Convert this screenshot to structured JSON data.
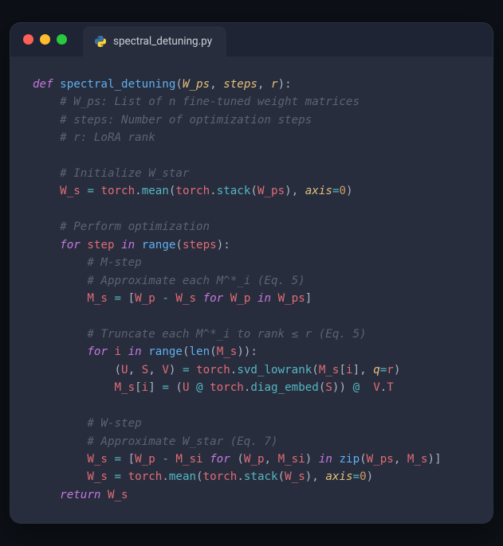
{
  "tab": {
    "filename": "spectral_detuning.py"
  },
  "code": {
    "lines": [
      {
        "indent": 0,
        "tokens": [
          [
            "kw",
            "def"
          ],
          [
            "",
            " "
          ],
          [
            "fn",
            "spectral_detuning"
          ],
          [
            "punct",
            "("
          ],
          [
            "param",
            "W_ps"
          ],
          [
            "punct",
            ","
          ],
          [
            "",
            " "
          ],
          [
            "param",
            "steps"
          ],
          [
            "punct",
            ","
          ],
          [
            "",
            " "
          ],
          [
            "param",
            "r"
          ],
          [
            "punct",
            "):"
          ]
        ]
      },
      {
        "indent": 1,
        "tokens": [
          [
            "comment",
            "# W_ps: List of n fine-tuned weight matrices"
          ]
        ]
      },
      {
        "indent": 1,
        "tokens": [
          [
            "comment",
            "# steps: Number of optimization steps"
          ]
        ]
      },
      {
        "indent": 1,
        "tokens": [
          [
            "comment",
            "# r: LoRA rank"
          ]
        ]
      },
      {
        "indent": 0,
        "tokens": []
      },
      {
        "indent": 1,
        "tokens": [
          [
            "comment",
            "# Initialize W_star"
          ]
        ]
      },
      {
        "indent": 1,
        "tokens": [
          [
            "var",
            "W_s"
          ],
          [
            "",
            " "
          ],
          [
            "op",
            "="
          ],
          [
            "",
            " "
          ],
          [
            "var",
            "torch"
          ],
          [
            "punct",
            "."
          ],
          [
            "method",
            "mean"
          ],
          [
            "punct",
            "("
          ],
          [
            "var",
            "torch"
          ],
          [
            "punct",
            "."
          ],
          [
            "method",
            "stack"
          ],
          [
            "punct",
            "("
          ],
          [
            "var",
            "W_ps"
          ],
          [
            "punct",
            "),"
          ],
          [
            "",
            " "
          ],
          [
            "param",
            "axis"
          ],
          [
            "op",
            "="
          ],
          [
            "num",
            "0"
          ],
          [
            "punct",
            ")"
          ]
        ]
      },
      {
        "indent": 0,
        "tokens": []
      },
      {
        "indent": 1,
        "tokens": [
          [
            "comment",
            "# Perform optimization"
          ]
        ]
      },
      {
        "indent": 1,
        "tokens": [
          [
            "kw",
            "for"
          ],
          [
            "",
            " "
          ],
          [
            "var",
            "step"
          ],
          [
            "",
            " "
          ],
          [
            "kw",
            "in"
          ],
          [
            "",
            " "
          ],
          [
            "fn",
            "range"
          ],
          [
            "punct",
            "("
          ],
          [
            "var",
            "steps"
          ],
          [
            "punct",
            "):"
          ]
        ]
      },
      {
        "indent": 2,
        "tokens": [
          [
            "comment",
            "# M-step"
          ]
        ]
      },
      {
        "indent": 2,
        "tokens": [
          [
            "comment",
            "# Approximate each M^*_i (Eq. 5)"
          ]
        ]
      },
      {
        "indent": 2,
        "tokens": [
          [
            "var",
            "M_s"
          ],
          [
            "",
            " "
          ],
          [
            "op",
            "="
          ],
          [
            "",
            " "
          ],
          [
            "punct",
            "["
          ],
          [
            "var",
            "W_p"
          ],
          [
            "",
            " "
          ],
          [
            "op",
            "-"
          ],
          [
            "",
            " "
          ],
          [
            "var",
            "W_s"
          ],
          [
            "",
            " "
          ],
          [
            "kw",
            "for"
          ],
          [
            "",
            " "
          ],
          [
            "var",
            "W_p"
          ],
          [
            "",
            " "
          ],
          [
            "kw",
            "in"
          ],
          [
            "",
            " "
          ],
          [
            "var",
            "W_ps"
          ],
          [
            "punct",
            "]"
          ]
        ]
      },
      {
        "indent": 0,
        "tokens": []
      },
      {
        "indent": 2,
        "tokens": [
          [
            "comment",
            "# Truncate each M^*_i to rank ≤ r (Eq. 5)"
          ]
        ]
      },
      {
        "indent": 2,
        "tokens": [
          [
            "kw",
            "for"
          ],
          [
            "",
            " "
          ],
          [
            "var",
            "i"
          ],
          [
            "",
            " "
          ],
          [
            "kw",
            "in"
          ],
          [
            "",
            " "
          ],
          [
            "fn",
            "range"
          ],
          [
            "punct",
            "("
          ],
          [
            "fn",
            "len"
          ],
          [
            "punct",
            "("
          ],
          [
            "var",
            "M_s"
          ],
          [
            "punct",
            ")):"
          ]
        ]
      },
      {
        "indent": 3,
        "tokens": [
          [
            "punct",
            "("
          ],
          [
            "var",
            "U"
          ],
          [
            "punct",
            ","
          ],
          [
            "",
            " "
          ],
          [
            "var",
            "S"
          ],
          [
            "punct",
            ","
          ],
          [
            "",
            " "
          ],
          [
            "var",
            "V"
          ],
          [
            "punct",
            ")"
          ],
          [
            "",
            " "
          ],
          [
            "op",
            "="
          ],
          [
            "",
            " "
          ],
          [
            "var",
            "torch"
          ],
          [
            "punct",
            "."
          ],
          [
            "method",
            "svd_lowrank"
          ],
          [
            "punct",
            "("
          ],
          [
            "var",
            "M_s"
          ],
          [
            "punct",
            "["
          ],
          [
            "var",
            "i"
          ],
          [
            "punct",
            "],"
          ],
          [
            "",
            " "
          ],
          [
            "param",
            "q"
          ],
          [
            "op",
            "="
          ],
          [
            "var",
            "r"
          ],
          [
            "punct",
            ")"
          ]
        ]
      },
      {
        "indent": 3,
        "tokens": [
          [
            "var",
            "M_s"
          ],
          [
            "punct",
            "["
          ],
          [
            "var",
            "i"
          ],
          [
            "punct",
            "]"
          ],
          [
            "",
            " "
          ],
          [
            "op",
            "="
          ],
          [
            "",
            " "
          ],
          [
            "punct",
            "("
          ],
          [
            "var",
            "U"
          ],
          [
            "",
            " "
          ],
          [
            "at",
            "@"
          ],
          [
            "",
            " "
          ],
          [
            "var",
            "torch"
          ],
          [
            "punct",
            "."
          ],
          [
            "method",
            "diag_embed"
          ],
          [
            "punct",
            "("
          ],
          [
            "var",
            "S"
          ],
          [
            "punct",
            "))"
          ],
          [
            "",
            " "
          ],
          [
            "at",
            "@"
          ],
          [
            "",
            "  "
          ],
          [
            "var",
            "V"
          ],
          [
            "punct",
            "."
          ],
          [
            "prop",
            "T"
          ]
        ]
      },
      {
        "indent": 0,
        "tokens": []
      },
      {
        "indent": 2,
        "tokens": [
          [
            "comment",
            "# W-step"
          ]
        ]
      },
      {
        "indent": 2,
        "tokens": [
          [
            "comment",
            "# Approximate W_star (Eq. 7)"
          ]
        ]
      },
      {
        "indent": 2,
        "tokens": [
          [
            "var",
            "W_s"
          ],
          [
            "",
            " "
          ],
          [
            "op",
            "="
          ],
          [
            "",
            " "
          ],
          [
            "punct",
            "["
          ],
          [
            "var",
            "W_p"
          ],
          [
            "",
            " "
          ],
          [
            "op",
            "-"
          ],
          [
            "",
            " "
          ],
          [
            "var",
            "M_si"
          ],
          [
            "",
            " "
          ],
          [
            "kw",
            "for"
          ],
          [
            "",
            " "
          ],
          [
            "punct",
            "("
          ],
          [
            "var",
            "W_p"
          ],
          [
            "punct",
            ","
          ],
          [
            "",
            " "
          ],
          [
            "var",
            "M_si"
          ],
          [
            "punct",
            ")"
          ],
          [
            "",
            " "
          ],
          [
            "kw",
            "in"
          ],
          [
            "",
            " "
          ],
          [
            "fn",
            "zip"
          ],
          [
            "punct",
            "("
          ],
          [
            "var",
            "W_ps"
          ],
          [
            "punct",
            ","
          ],
          [
            "",
            " "
          ],
          [
            "var",
            "M_s"
          ],
          [
            "punct",
            ")]"
          ]
        ]
      },
      {
        "indent": 2,
        "tokens": [
          [
            "var",
            "W_s"
          ],
          [
            "",
            " "
          ],
          [
            "op",
            "="
          ],
          [
            "",
            " "
          ],
          [
            "var",
            "torch"
          ],
          [
            "punct",
            "."
          ],
          [
            "method",
            "mean"
          ],
          [
            "punct",
            "("
          ],
          [
            "var",
            "torch"
          ],
          [
            "punct",
            "."
          ],
          [
            "method",
            "stack"
          ],
          [
            "punct",
            "("
          ],
          [
            "var",
            "W_s"
          ],
          [
            "punct",
            "),"
          ],
          [
            "",
            " "
          ],
          [
            "param",
            "axis"
          ],
          [
            "op",
            "="
          ],
          [
            "num",
            "0"
          ],
          [
            "punct",
            ")"
          ]
        ]
      },
      {
        "indent": 1,
        "tokens": [
          [
            "kw",
            "return"
          ],
          [
            "",
            " "
          ],
          [
            "var",
            "W_s"
          ]
        ]
      }
    ]
  }
}
